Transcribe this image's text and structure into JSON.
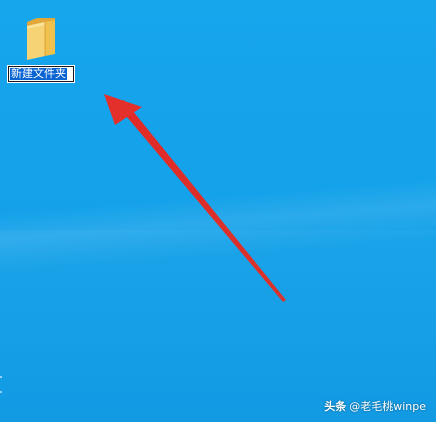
{
  "desktop": {
    "background_color": "#14a2ea",
    "folder": {
      "icon": "folder-icon",
      "name_editing": "新建文件夹",
      "selection_color": "#0a64d2"
    }
  },
  "annotation": {
    "color": "#e8302b",
    "shape": "arrow-pointing-to-folder-name"
  },
  "watermark": {
    "brand": "头条",
    "handle": "@老毛桃winpe"
  }
}
